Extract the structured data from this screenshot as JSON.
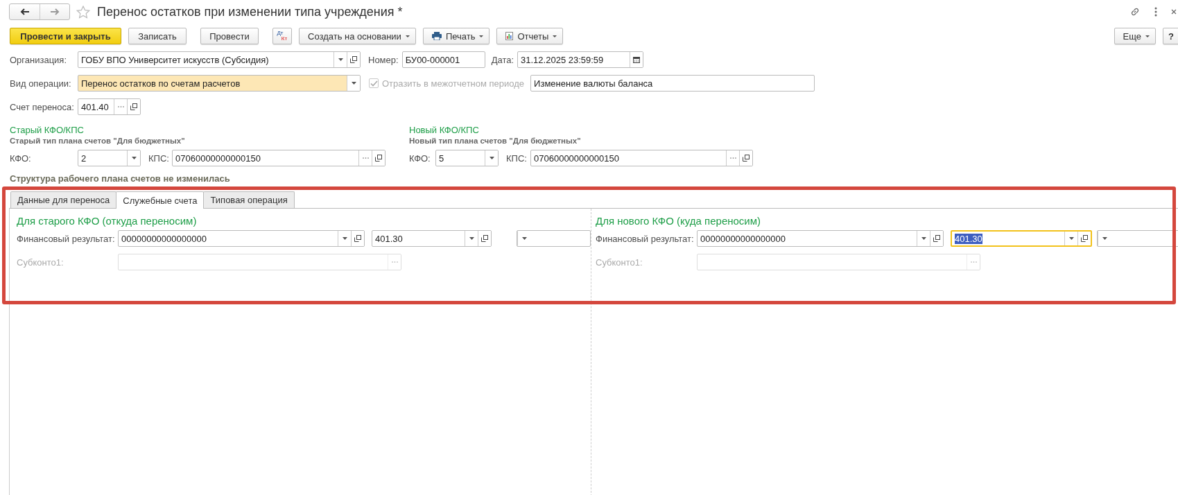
{
  "window": {
    "title": "Перенос остатков при изменении типа учреждения *"
  },
  "toolbar": {
    "buttons": [
      {
        "kind": "primary",
        "label": "Провести и закрыть"
      },
      {
        "kind": "plain",
        "label": "Записать"
      },
      {
        "kind": "plain",
        "label": "Провести"
      },
      {
        "kind": "dtkt",
        "label": "Дт",
        "sublabel": "Кт"
      },
      {
        "kind": "menu",
        "label": "Создать на основании"
      },
      {
        "kind": "print",
        "label": "Печать"
      },
      {
        "kind": "reports",
        "label": "Отчеты"
      }
    ],
    "more": "Еще",
    "help": "?"
  },
  "header": {
    "organization": {
      "label": "Организация:",
      "value": "ГОБУ ВПО Университет искусств (Субсидия)"
    },
    "number": {
      "label": "Номер:",
      "value": "БУ00-000001"
    },
    "date": {
      "label": "Дата:",
      "value": "31.12.2025 23:59:59"
    },
    "operation": {
      "label": "Вид операции:",
      "value": "Перенос остатков по счетам расчетов"
    },
    "interperiod": {
      "label": "Отразить в межотчетном периоде",
      "checked": true,
      "disabled": true
    },
    "currency_change": {
      "value": "Изменение валюты баланса"
    },
    "transfer_account": {
      "label": "Счет переноса:",
      "value": "401.40"
    }
  },
  "kfo_groups": [
    {
      "heading": "Старый КФО/КПС",
      "subtitle": "Старый тип плана счетов \"Для бюджетных\"",
      "kfo_label": "КФО:",
      "kfo_value": "2",
      "kps_label": "КПС:",
      "kps_value": "07060000000000150"
    },
    {
      "heading": "Новый КФО/КПС",
      "subtitle": "Новый тип плана счетов \"Для бюджетных\"",
      "kfo_label": "КФО:",
      "kfo_value": "5",
      "kps_label": "КПС:",
      "kps_value": "07060000000000150"
    }
  ],
  "structure_note": "Структура рабочего плана счетов не изменилась",
  "tabs": [
    {
      "label": "Данные для переноса",
      "selected": false
    },
    {
      "label": "Служебные счета",
      "selected": true
    },
    {
      "label": "Типовая операция",
      "selected": false
    }
  ],
  "panels": [
    {
      "heading": "Для старого КФО (откуда переносим)",
      "fin_label": "Финансовый результат:",
      "fin_value": "00000000000000000",
      "account_value": "401.30",
      "account_focused": false,
      "sub_label": "Субконто1:",
      "sub_disabled": true
    },
    {
      "heading": "Для нового КФО (куда переносим)",
      "fin_label": "Финансовый результат:",
      "fin_value": "00000000000000000",
      "account_value": "401.30",
      "account_focused": true,
      "sub_label": "Субконто1:",
      "sub_disabled": true
    }
  ]
}
